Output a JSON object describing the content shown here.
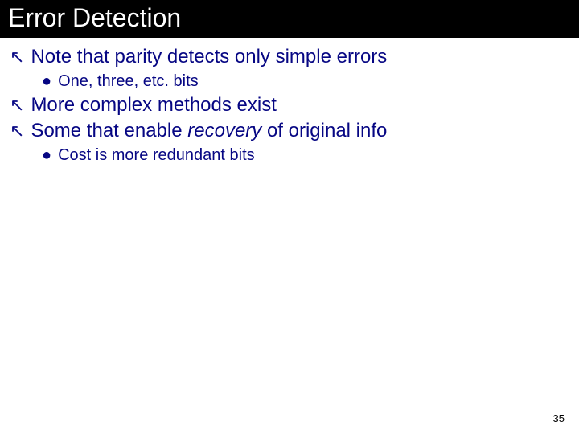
{
  "title": "Error Detection",
  "bullets": {
    "b1": "Note that parity detects only simple errors",
    "b1_1": "One, three, etc. bits",
    "b2": "More complex methods exist",
    "b3_pre": "Some that enable ",
    "b3_em": "recovery",
    "b3_post": " of original info",
    "b3_1": "Cost is more redundant bits"
  },
  "page_number": "35"
}
